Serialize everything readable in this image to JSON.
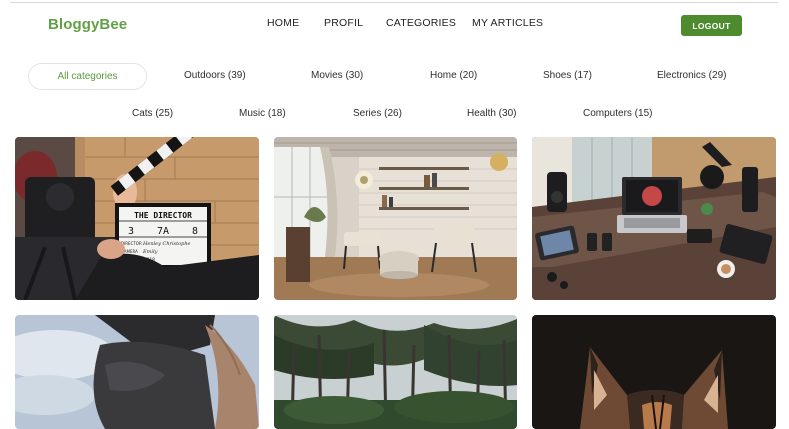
{
  "brand": "BloggyBee",
  "nav": {
    "home": "HOME",
    "profil": "PROFIL",
    "categories": "CATEGORIES",
    "my_articles": "MY ARTICLES",
    "logout": "LOGOUT"
  },
  "categories": {
    "all": "All categories",
    "outdoors": "Outdoors (39)",
    "movies": "Movies (30)",
    "home": "Home (20)",
    "shoes": "Shoes (17)",
    "electronics": "Electronics (29)",
    "cats": "Cats (25)",
    "music": "Music (18)",
    "series": "Series (26)",
    "health": "Health (30)",
    "computers": "Computers (15)"
  },
  "clapper": {
    "title": "THE DIRECTOR",
    "roll": "3",
    "scene": "7A",
    "take": "8",
    "director_label": "DIRECTOR",
    "director": "Henley Christophe",
    "camera_label": "CAMERA",
    "camera": "Emily",
    "date_label": "DATE",
    "date": "25. 2018"
  },
  "colors": {
    "brand": "#62a046",
    "logout_bg": "#4e8a2e",
    "active_category": "#5a9b3d"
  }
}
